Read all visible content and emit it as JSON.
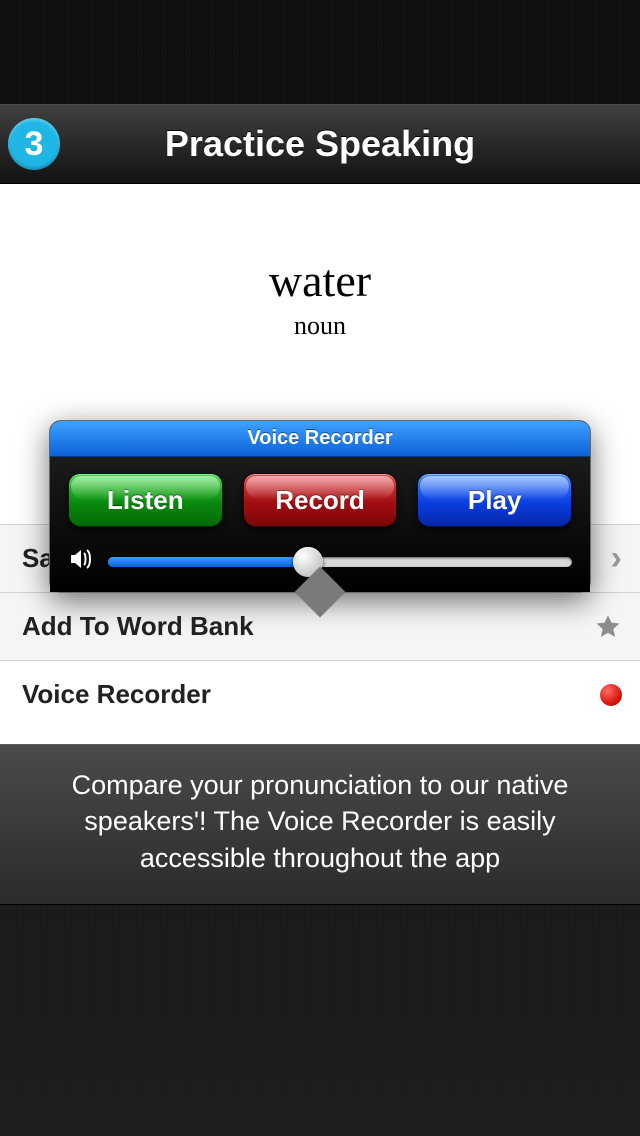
{
  "header": {
    "step_number": "3",
    "title": "Practice Speaking"
  },
  "word": {
    "text": "water",
    "part_of_speech": "noun"
  },
  "rows": {
    "row0": {
      "label": "Sa"
    },
    "row1": {
      "label": "Add To Word Bank"
    },
    "row2": {
      "label": "Voice Recorder"
    }
  },
  "recorder": {
    "title": "Voice Recorder",
    "listen_label": "Listen",
    "record_label": "Record",
    "play_label": "Play",
    "volume_percent": 43
  },
  "caption": "Compare your pronunciation to our native speakers'! The Voice Recorder is easily accessible throughout the app",
  "colors": {
    "accent_badge": "#1fb6e6"
  }
}
